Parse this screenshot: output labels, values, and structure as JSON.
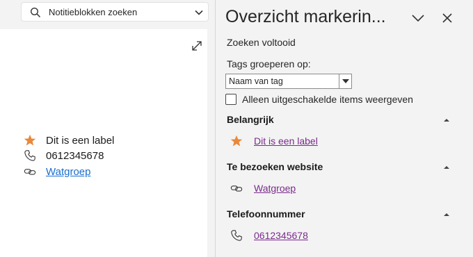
{
  "search": {
    "placeholder": "Notitieblokken zoeken",
    "icon": "search-icon",
    "dropdown_icon": "chevron-down-icon"
  },
  "page": {
    "expand_icon": "expand-icon",
    "lines": [
      {
        "icon": "star-icon",
        "text": "Dit is een label",
        "is_link": false
      },
      {
        "icon": "phone-icon",
        "text": "0612345678",
        "is_link": false
      },
      {
        "icon": "link-icon",
        "text": "Watgroep",
        "is_link": true
      }
    ]
  },
  "panel": {
    "title": "Overzicht markerin...",
    "status": "Zoeken voltooid",
    "group_label": "Tags groeperen op:",
    "group_select_value": "Naam van tag",
    "checkbox_label": "Alleen uitgeschakelde items weergeven",
    "checkbox_checked": false,
    "sections": [
      {
        "title": "Belangrijk",
        "item_icon": "star-icon",
        "item_text": "Dit is een label"
      },
      {
        "title": "Te bezoeken website",
        "item_icon": "link-icon",
        "item_text": "Watgroep"
      },
      {
        "title": "Telefoonnummer",
        "item_icon": "phone-icon",
        "item_text": "0612345678"
      }
    ]
  },
  "colors": {
    "star": "#e8883a",
    "link_note": "#1a6ecb",
    "link_panel": "#7a2a8c",
    "background": "#f3f3f3"
  }
}
